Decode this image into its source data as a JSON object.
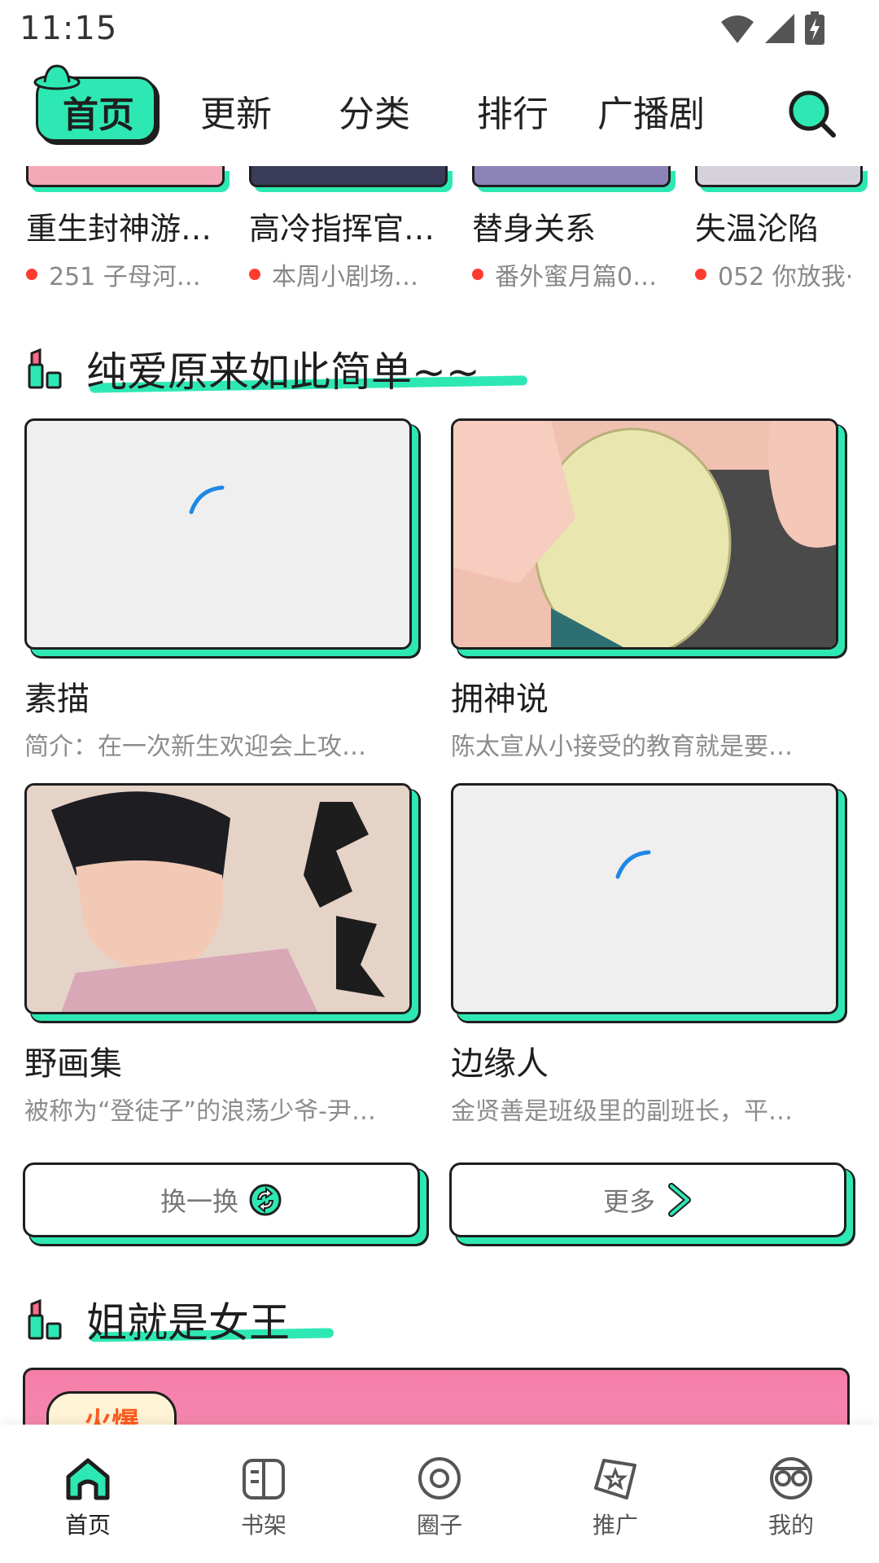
{
  "status_bar": {
    "time": "11:15"
  },
  "top_nav": {
    "tabs": [
      {
        "label": "首页",
        "active": true
      },
      {
        "label": "更新"
      },
      {
        "label": "分类"
      },
      {
        "label": "排行"
      },
      {
        "label": "广播剧"
      }
    ]
  },
  "strip": [
    {
      "title": "重生封神游…",
      "subtitle": "251 子母河…"
    },
    {
      "title": "高冷指挥官…",
      "subtitle": "本周小剧场…"
    },
    {
      "title": "替身关系",
      "subtitle": "番外蜜月篇0…"
    },
    {
      "title": "失温沦陷",
      "subtitle": "052 你放我·"
    }
  ],
  "section1": {
    "title": "纯爱原来如此简单~~",
    "cards": [
      {
        "title": "素描",
        "desc": "简介：在一次新生欢迎会上攻…",
        "loading": true
      },
      {
        "title": "拥神说",
        "desc": "陈太宣从小接受的教育就是要…"
      },
      {
        "title": "野画集",
        "desc": "被称为“登徒子”的浪荡少爷-尹…"
      },
      {
        "title": "边缘人",
        "desc": "金贤善是班级里的副班长，平…",
        "loading": true
      }
    ],
    "refresh_label": "换一换",
    "more_label": "更多"
  },
  "section2": {
    "title": "姐就是女王",
    "banner_badge": "火爆"
  },
  "bottom_nav": [
    {
      "label": "首页",
      "icon": "home-icon",
      "active": true
    },
    {
      "label": "书架",
      "icon": "bookshelf-icon"
    },
    {
      "label": "圈子",
      "icon": "circle-icon"
    },
    {
      "label": "推广",
      "icon": "promote-icon"
    },
    {
      "label": "我的",
      "icon": "profile-icon"
    }
  ],
  "colors": {
    "accent": "#2ee8b4",
    "ink": "#1e1e1e",
    "dot": "#ff3b30",
    "spinner": "#1e88e5"
  }
}
